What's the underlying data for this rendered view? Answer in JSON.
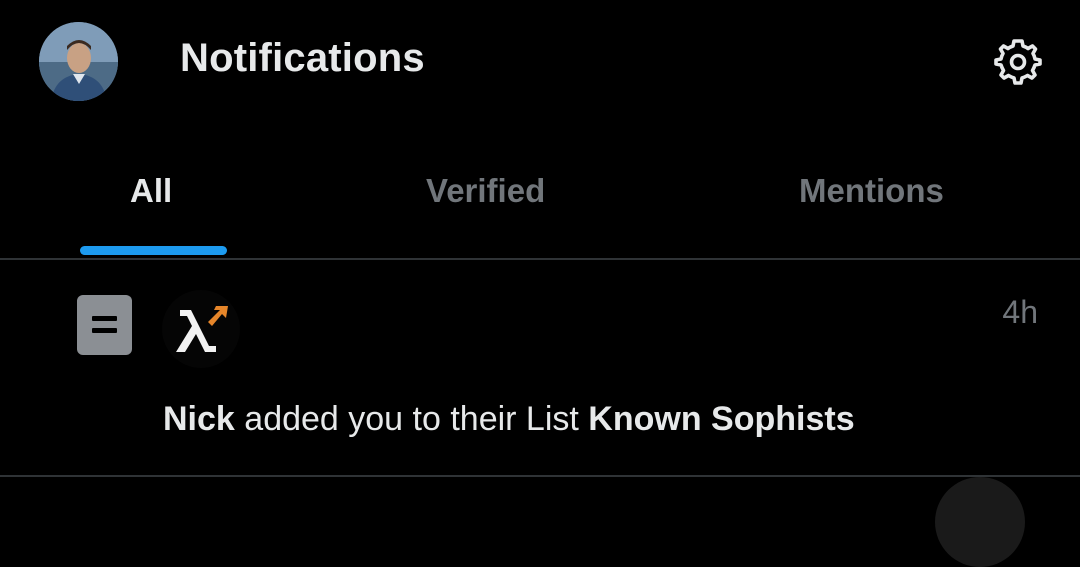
{
  "header": {
    "title": "Notifications",
    "avatar_icon": "profile-photo",
    "settings_icon": "gear-icon"
  },
  "tabs": [
    {
      "label": "All",
      "active": true
    },
    {
      "label": "Verified",
      "active": false
    },
    {
      "label": "Mentions",
      "active": false
    }
  ],
  "notification": {
    "type_icon": "list-icon",
    "actor_icon": "lambda-logo",
    "time": "4h",
    "actor": "Nick",
    "action": "added you to their List",
    "list_name": "Known Sophists"
  },
  "colors": {
    "background": "#000000",
    "accent": "#1d9bf0",
    "primary_text": "#e7e9ea",
    "secondary_text": "#71767b",
    "divider": "#2f3336",
    "list_icon_bg": "#8b8f94"
  }
}
